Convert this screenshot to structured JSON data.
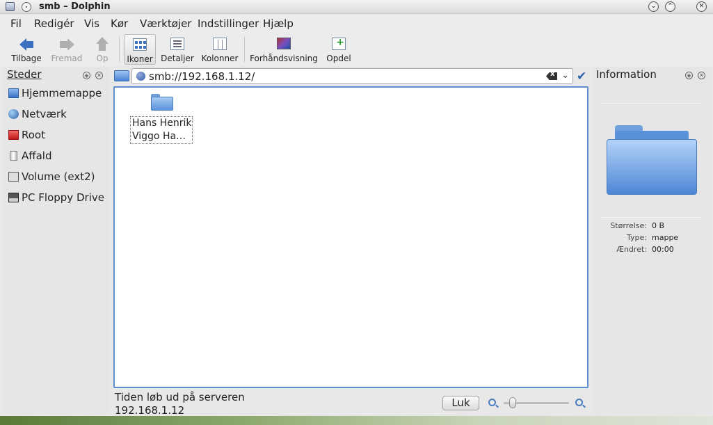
{
  "window": {
    "title": "smb – Dolphin"
  },
  "menu": [
    "Fil",
    "Redigér",
    "Vis",
    "Kør",
    "Værktøjer",
    "Indstillinger",
    "Hjælp"
  ],
  "toolbar": {
    "back": "Tilbage",
    "forward": "Fremad",
    "up": "Op",
    "icons": "Ikoner",
    "details": "Detaljer",
    "columns": "Kolonner",
    "preview": "Forhåndsvisning",
    "split": "Opdel"
  },
  "places": {
    "title": "Steder",
    "items": [
      {
        "label": "Hjemmemappe",
        "icon": "home-icon"
      },
      {
        "label": "Netværk",
        "icon": "network-icon"
      },
      {
        "label": "Root",
        "icon": "root-folder-icon"
      },
      {
        "label": "Affald",
        "icon": "trash-icon"
      },
      {
        "label": "Volume (ext2)",
        "icon": "drive-icon"
      },
      {
        "label": "PC Floppy Drive",
        "icon": "floppy-icon"
      }
    ]
  },
  "location": {
    "url": "smb://192.168.1.12/"
  },
  "view": {
    "items": [
      {
        "line1": "Hans Henrik",
        "line2": "Viggo Ha…"
      }
    ]
  },
  "status": {
    "line1": "Tiden løb ud på serveren",
    "line2": "192.168.1.12",
    "close": "Luk",
    "zoom_level": 0.1
  },
  "info": {
    "title": "Information",
    "size_label": "Størrelse:",
    "size_value": "0 B",
    "type_label": "Type:",
    "type_value": "mappe",
    "modified_label": "Ændret:",
    "modified_value": "00:00"
  },
  "colors": {
    "selection": "#5b8fd0",
    "folder": "#5a92dc"
  }
}
